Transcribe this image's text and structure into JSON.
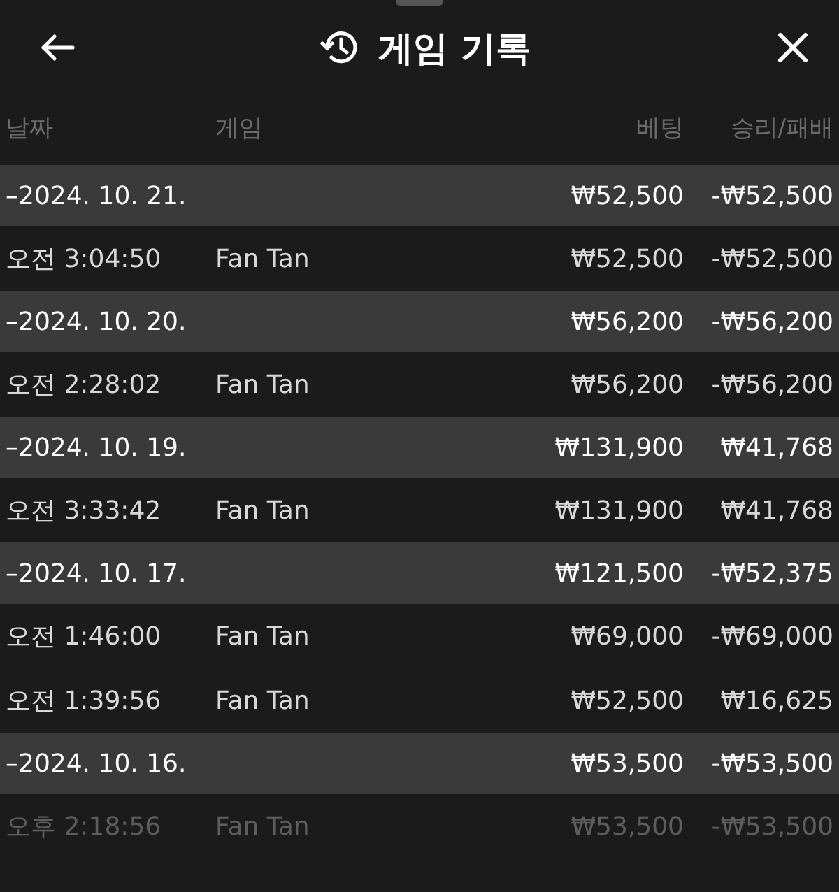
{
  "header": {
    "title": "게임 기록"
  },
  "columns": [
    "날짜",
    "게임",
    "베팅",
    "승리/패배"
  ],
  "groups": [
    {
      "date": "–2024. 10. 21.",
      "bet": "₩52,500",
      "result": "-₩52,500",
      "items": [
        {
          "time": "오전 3:04:50",
          "game": "Fan Tan",
          "bet": "₩52,500",
          "result": "-₩52,500"
        }
      ]
    },
    {
      "date": "–2024. 10. 20.",
      "bet": "₩56,200",
      "result": "-₩56,200",
      "items": [
        {
          "time": "오전 2:28:02",
          "game": "Fan Tan",
          "bet": "₩56,200",
          "result": "-₩56,200"
        }
      ]
    },
    {
      "date": "–2024. 10. 19.",
      "bet": "₩131,900",
      "result": "₩41,768",
      "items": [
        {
          "time": "오전 3:33:42",
          "game": "Fan Tan",
          "bet": "₩131,900",
          "result": "₩41,768"
        }
      ]
    },
    {
      "date": "–2024. 10. 17.",
      "bet": "₩121,500",
      "result": "-₩52,375",
      "items": [
        {
          "time": "오전 1:46:00",
          "game": "Fan Tan",
          "bet": "₩69,000",
          "result": "-₩69,000"
        },
        {
          "time": "오전 1:39:56",
          "game": "Fan Tan",
          "bet": "₩52,500",
          "result": "₩16,625"
        }
      ]
    },
    {
      "date": "–2024. 10. 16.",
      "bet": "₩53,500",
      "result": "-₩53,500",
      "items": [
        {
          "time": "오후 2:18:56",
          "game": "Fan Tan",
          "bet": "₩53,500",
          "result": "-₩53,500"
        }
      ]
    }
  ]
}
